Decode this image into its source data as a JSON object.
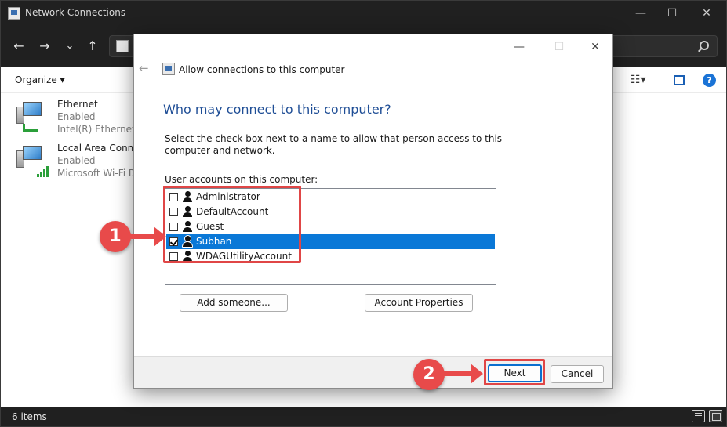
{
  "explorer": {
    "title": "Network Connections",
    "window_controls": {
      "minimize": "—",
      "maximize": "☐",
      "close": "✕"
    },
    "nav": {
      "back": "←",
      "forward": "→",
      "recent": "⌄",
      "up": "↑"
    },
    "cmdbar": {
      "organize_label": "Organize ▾",
      "help_label": "?"
    },
    "connections": [
      {
        "name": "Ethernet",
        "status": "Enabled",
        "adapter": "Intel(R) Ethernet Co",
        "icon": "ethernet-pc-icon"
      },
      {
        "name": "Local Area Connec",
        "status": "Enabled",
        "adapter": "Microsoft Wi-Fi Di",
        "icon": "wifi-pc-icon"
      }
    ],
    "status_bar": {
      "item_count": "6 items"
    }
  },
  "dialog": {
    "window_controls": {
      "minimize": "—",
      "maximize": "☐",
      "close": "✕"
    },
    "back_arrow": "←",
    "header_title": "Allow connections to this computer",
    "heading": "Who may connect to this computer?",
    "description": "Select the check box next to a name to allow that person access to this computer and network.",
    "list_label": "User accounts on this computer:",
    "users": [
      {
        "name": "Administrator",
        "checked": false,
        "selected": false
      },
      {
        "name": "DefaultAccount",
        "checked": false,
        "selected": false
      },
      {
        "name": "Guest",
        "checked": false,
        "selected": false
      },
      {
        "name": "Subhan",
        "checked": true,
        "selected": true
      },
      {
        "name": "WDAGUtilityAccount",
        "checked": false,
        "selected": false
      }
    ],
    "add_someone_label": "Add someone...",
    "account_properties_label": "Account Properties",
    "next_label": "Next",
    "cancel_label": "Cancel"
  },
  "annotations": {
    "step1": "1",
    "step2": "2",
    "accent_color": "#e84a4a"
  }
}
